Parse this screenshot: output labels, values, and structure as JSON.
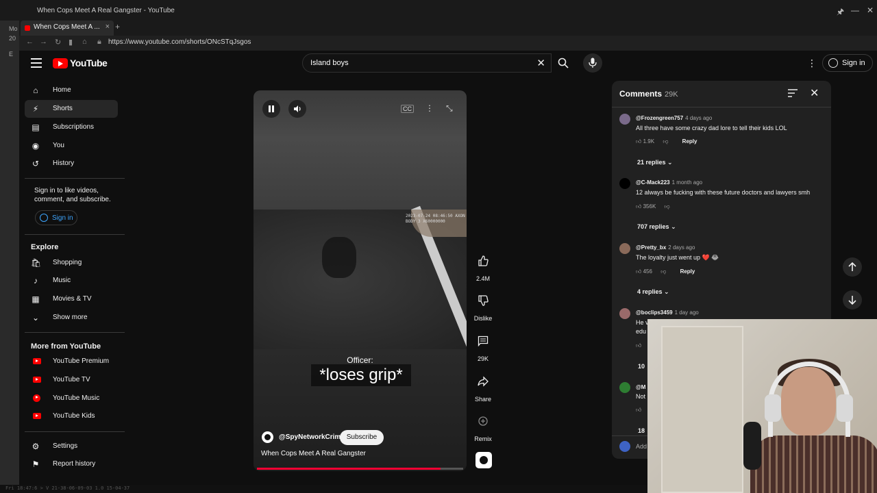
{
  "window": {
    "title": "When Cops Meet A Real Gangster - YouTube",
    "tab_title": "When Cops Meet A ...",
    "url": "https://www.youtube.com/shorts/ONcSTqJsgos"
  },
  "left_strip": {
    "top": "10",
    "line1": "Mo",
    "line2": "20",
    "line3": "E"
  },
  "header": {
    "logo_text": "YouTube",
    "search_value": "Island boys",
    "signin_label": "Sign in"
  },
  "sidebar": {
    "main": [
      {
        "label": "Home",
        "icon": "home-icon"
      },
      {
        "label": "Shorts",
        "icon": "shorts-icon"
      },
      {
        "label": "Subscriptions",
        "icon": "subscriptions-icon"
      },
      {
        "label": "You",
        "icon": "you-icon"
      },
      {
        "label": "History",
        "icon": "history-icon"
      }
    ],
    "signin_prompt": "Sign in to like videos, comment, and subscribe.",
    "signin_label": "Sign in",
    "explore_heading": "Explore",
    "explore": [
      {
        "label": "Shopping",
        "icon": "shopping-icon"
      },
      {
        "label": "Music",
        "icon": "music-icon"
      },
      {
        "label": "Movies & TV",
        "icon": "movies-icon"
      },
      {
        "label": "Show more",
        "icon": "chevron-down-icon"
      }
    ],
    "more_heading": "More from YouTube",
    "more": [
      {
        "label": "YouTube Premium"
      },
      {
        "label": "YouTube TV"
      },
      {
        "label": "YouTube Music"
      },
      {
        "label": "YouTube Kids"
      }
    ],
    "bottom": [
      {
        "label": "Settings",
        "icon": "settings-icon"
      },
      {
        "label": "Report history",
        "icon": "flag-icon"
      }
    ]
  },
  "video": {
    "caption_small": "Officer:",
    "caption_big": "*loses grip*",
    "channel": "@SpyNetworkCrime",
    "subscribe_label": "Subscribe",
    "title": "When Cops Meet A Real Gangster",
    "progress": 0.89,
    "stamp": "2023-07-24 08:46:50 AXON BODY 3 X60000000"
  },
  "actions": {
    "likes": "2.4M",
    "dislike": "Dislike",
    "comments": "29K",
    "share": "Share",
    "remix": "Remix"
  },
  "comments": {
    "heading": "Comments",
    "count": "29K",
    "items": [
      {
        "user": "@Frozengreen757",
        "time": "4 days ago",
        "text": "All three have some crazy dad lore to tell their kids LOL",
        "likes": "1.9K",
        "reply": "Reply",
        "replies": "21 replies"
      },
      {
        "user": "@C-Mack223",
        "time": "1 month ago",
        "text": "12 always be fucking with these future doctors and lawyers smh",
        "likes": "356K",
        "reply": "",
        "replies": "707 replies"
      },
      {
        "user": "@Pretty_bx",
        "time": "2 days ago",
        "text": "The loyalty just went up ❤️ 😂",
        "likes": "456",
        "reply": "Reply",
        "replies": "4 replies"
      },
      {
        "user": "@boclips3459",
        "time": "1 day ago",
        "text": "He v",
        "text2": "edu",
        "likes": "",
        "reply": "",
        "replies": "10"
      },
      {
        "user": "@M",
        "time": "",
        "text": "Not",
        "likes": "",
        "reply": "",
        "replies": "18"
      }
    ],
    "add_placeholder": "Add"
  },
  "statusbar": "Fri 18:47:6 > V 21-38-06-09-03 1.0 15-04-37"
}
